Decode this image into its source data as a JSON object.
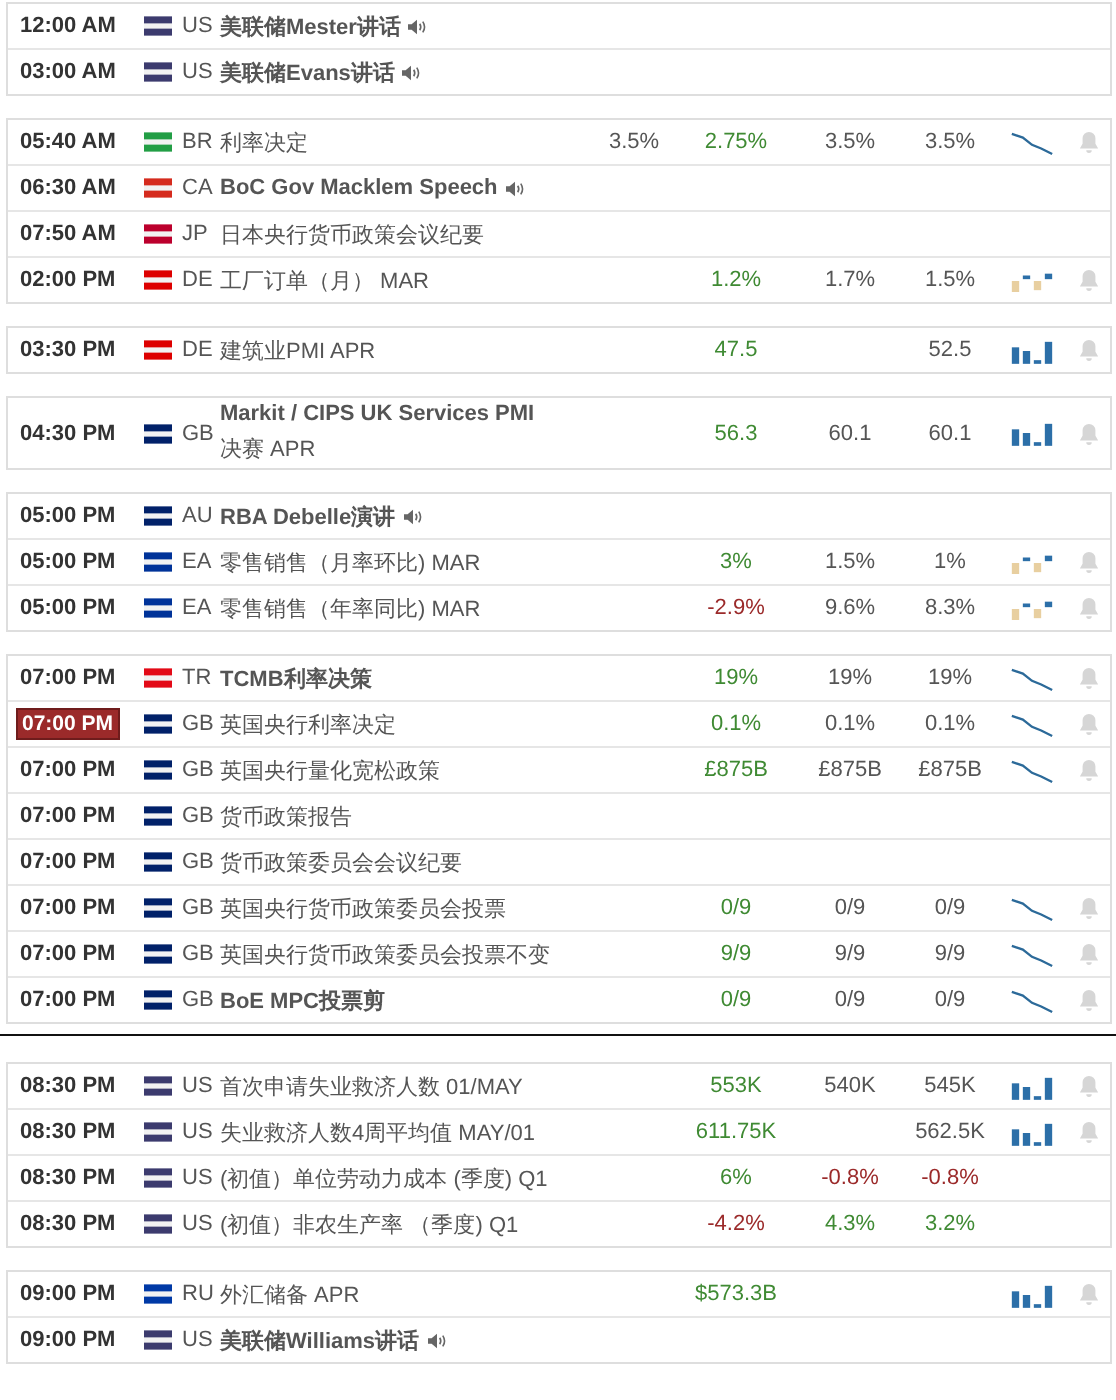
{
  "groups": [
    {
      "divider_after": false,
      "rows": [
        {
          "time": "12:00 AM",
          "highlighted": false,
          "color": "#3c3b6e",
          "country": "US",
          "title": "美联储Mester讲话",
          "bold": true,
          "speech": true,
          "alert": false
        },
        {
          "time": "03:00 AM",
          "highlighted": false,
          "color": "#3c3b6e",
          "country": "US",
          "title": "美联储Evans讲话",
          "bold": true,
          "speech": true,
          "alert": false
        }
      ]
    },
    {
      "divider_after": false,
      "rows": [
        {
          "time": "05:40 AM",
          "highlighted": false,
          "color": "#229e45",
          "country": "BR",
          "title": "利率决定",
          "bold": false,
          "speech": false,
          "column_1": {
            "text": "3.5%",
            "color": "#555555"
          },
          "column_2": {
            "text": "2.75%",
            "color": "#3f8a33"
          },
          "column_3": {
            "text": "3.5%",
            "color": "#555555"
          },
          "column_4": {
            "text": "3.5%",
            "color": "#555555"
          },
          "sparkline": {
            "kind": "line"
          },
          "alert": true
        },
        {
          "time": "06:30 AM",
          "highlighted": false,
          "color": "#d52b1e",
          "country": "CA",
          "title": "BoC Gov Macklem Speech",
          "bold": true,
          "speech": true,
          "alert": false
        },
        {
          "time": "07:50 AM",
          "highlighted": false,
          "color": "#bc002d",
          "country": "JP",
          "title": "日本央行货币政策会议纪要",
          "bold": false,
          "speech": false,
          "alert": false
        },
        {
          "time": "02:00 PM",
          "highlighted": false,
          "color": "#dd0000",
          "country": "DE",
          "title": "工厂订单（月） MAR",
          "bold": false,
          "speech": false,
          "column_2": {
            "text": "1.2%",
            "color": "#3f8a33"
          },
          "column_3": {
            "text": "1.7%",
            "color": "#555555"
          },
          "column_4": {
            "text": "1.5%",
            "color": "#555555"
          },
          "sparkline": {
            "kind": "mixed"
          },
          "alert": true
        }
      ]
    },
    {
      "divider_after": false,
      "rows": [
        {
          "time": "03:30 PM",
          "highlighted": false,
          "color": "#dd0000",
          "country": "DE",
          "title": "建筑业PMI APR",
          "bold": false,
          "speech": false,
          "column_2": {
            "text": "47.5",
            "color": "#3f8a33"
          },
          "column_4": {
            "text": "52.5",
            "color": "#555555"
          },
          "sparkline": {
            "kind": "bars"
          },
          "alert": true
        }
      ]
    },
    {
      "divider_after": false,
      "rows": [
        {
          "time": "04:30 PM",
          "highlighted": false,
          "color": "#012169",
          "country": "GB",
          "title": "Markit / CIPS UK Services PMI",
          "subtitle": "决赛 APR",
          "bold": true,
          "speech": false,
          "column_2": {
            "text": "56.3",
            "color": "#3f8a33"
          },
          "column_3": {
            "text": "60.1",
            "color": "#555555"
          },
          "column_4": {
            "text": "60.1",
            "color": "#555555"
          },
          "sparkline": {
            "kind": "bars"
          },
          "alert": true
        }
      ]
    },
    {
      "divider_after": false,
      "rows": [
        {
          "time": "05:00 PM",
          "highlighted": false,
          "color": "#012169",
          "country": "AU",
          "title": "RBA Debelle演讲",
          "bold": true,
          "speech": true,
          "alert": false
        },
        {
          "time": "05:00 PM",
          "highlighted": false,
          "color": "#003399",
          "country": "EA",
          "title": "零售销售（月率环比) MAR",
          "bold": false,
          "speech": false,
          "column_2": {
            "text": "3%",
            "color": "#3f8a33"
          },
          "column_3": {
            "text": "1.5%",
            "color": "#555555"
          },
          "column_4": {
            "text": "1%",
            "color": "#555555"
          },
          "sparkline": {
            "kind": "mixed"
          },
          "alert": true
        },
        {
          "time": "05:00 PM",
          "highlighted": false,
          "color": "#003399",
          "country": "EA",
          "title": "零售销售（年率同比) MAR",
          "bold": false,
          "speech": false,
          "column_2": {
            "text": "-2.9%",
            "color": "#9b2a2a"
          },
          "column_3": {
            "text": "9.6%",
            "color": "#555555"
          },
          "column_4": {
            "text": "8.3%",
            "color": "#555555"
          },
          "sparkline": {
            "kind": "mixed"
          },
          "alert": true
        }
      ]
    },
    {
      "divider_after": true,
      "rows": [
        {
          "time": "07:00 PM",
          "highlighted": false,
          "color": "#e30a17",
          "country": "TR",
          "title": "TCMB利率决策",
          "bold": true,
          "speech": false,
          "column_2": {
            "text": "19%",
            "color": "#3f8a33"
          },
          "column_3": {
            "text": "19%",
            "color": "#555555"
          },
          "column_4": {
            "text": "19%",
            "color": "#555555"
          },
          "sparkline": {
            "kind": "line"
          },
          "alert": true
        },
        {
          "time": "07:00 PM",
          "highlighted": true,
          "color": "#012169",
          "country": "GB",
          "title": "英国央行利率决定",
          "bold": false,
          "speech": false,
          "column_2": {
            "text": "0.1%",
            "color": "#3f8a33"
          },
          "column_3": {
            "text": "0.1%",
            "color": "#555555"
          },
          "column_4": {
            "text": "0.1%",
            "color": "#555555"
          },
          "sparkline": {
            "kind": "line"
          },
          "alert": true
        },
        {
          "time": "07:00 PM",
          "highlighted": false,
          "color": "#012169",
          "country": "GB",
          "title": "英国央行量化宽松政策",
          "bold": false,
          "speech": false,
          "column_2": {
            "text": "£875B",
            "color": "#3f8a33"
          },
          "column_3": {
            "text": "£875B",
            "color": "#555555"
          },
          "column_4": {
            "text": "£875B",
            "color": "#555555"
          },
          "sparkline": {
            "kind": "line"
          },
          "alert": true
        },
        {
          "time": "07:00 PM",
          "highlighted": false,
          "color": "#012169",
          "country": "GB",
          "title": "货币政策报告",
          "bold": false,
          "speech": false,
          "alert": false
        },
        {
          "time": "07:00 PM",
          "highlighted": false,
          "color": "#012169",
          "country": "GB",
          "title": "货币政策委员会会议纪要",
          "bold": false,
          "speech": false,
          "alert": false
        },
        {
          "time": "07:00 PM",
          "highlighted": false,
          "color": "#012169",
          "country": "GB",
          "title": "英国央行货币政策委员会投票",
          "bold": false,
          "speech": false,
          "column_2": {
            "text": "0/9",
            "color": "#3f8a33"
          },
          "column_3": {
            "text": "0/9",
            "color": "#555555"
          },
          "column_4": {
            "text": "0/9",
            "color": "#555555"
          },
          "sparkline": {
            "kind": "line"
          },
          "alert": true
        },
        {
          "time": "07:00 PM",
          "highlighted": false,
          "color": "#012169",
          "country": "GB",
          "title": "英国央行货币政策委员会投票不变",
          "bold": false,
          "speech": false,
          "column_2": {
            "text": "9/9",
            "color": "#3f8a33"
          },
          "column_3": {
            "text": "9/9",
            "color": "#555555"
          },
          "column_4": {
            "text": "9/9",
            "color": "#555555"
          },
          "sparkline": {
            "kind": "line"
          },
          "alert": true
        },
        {
          "time": "07:00 PM",
          "highlighted": false,
          "color": "#012169",
          "country": "GB",
          "title": "BoE MPC投票剪",
          "bold": true,
          "speech": false,
          "column_2": {
            "text": "0/9",
            "color": "#3f8a33"
          },
          "column_3": {
            "text": "0/9",
            "color": "#555555"
          },
          "column_4": {
            "text": "0/9",
            "color": "#555555"
          },
          "sparkline": {
            "kind": "line"
          },
          "alert": true
        }
      ]
    },
    {
      "divider_after": false,
      "rows": [
        {
          "time": "08:30 PM",
          "highlighted": false,
          "color": "#3c3b6e",
          "country": "US",
          "title": "首次申请失业救济人数 01/MAY",
          "bold": false,
          "speech": false,
          "column_2": {
            "text": "553K",
            "color": "#3f8a33"
          },
          "column_3": {
            "text": "540K",
            "color": "#555555"
          },
          "column_4": {
            "text": "545K",
            "color": "#555555"
          },
          "sparkline": {
            "kind": "bars"
          },
          "alert": true
        },
        {
          "time": "08:30 PM",
          "highlighted": false,
          "color": "#3c3b6e",
          "country": "US",
          "title": "失业救济人数4周平均值 MAY/01",
          "bold": false,
          "speech": false,
          "column_2": {
            "text": "611.75K",
            "color": "#3f8a33"
          },
          "column_4": {
            "text": "562.5K",
            "color": "#555555"
          },
          "sparkline": {
            "kind": "bars"
          },
          "alert": true
        },
        {
          "time": "08:30 PM",
          "highlighted": false,
          "color": "#3c3b6e",
          "country": "US",
          "title": "(初值）单位劳动力成本 (季度) Q1",
          "bold": false,
          "speech": false,
          "column_2": {
            "text": "6%",
            "color": "#3f8a33"
          },
          "column_3": {
            "text": "-0.8%",
            "color": "#9b2a2a"
          },
          "column_4": {
            "text": "-0.8%",
            "color": "#9b2a2a"
          },
          "alert": false
        },
        {
          "time": "08:30 PM",
          "highlighted": false,
          "color": "#3c3b6e",
          "country": "US",
          "title": "(初值）非农生产率 （季度) Q1",
          "bold": false,
          "speech": false,
          "column_2": {
            "text": "-4.2%",
            "color": "#9b2a2a"
          },
          "column_3": {
            "text": "4.3%",
            "color": "#3f8a33"
          },
          "column_4": {
            "text": "3.2%",
            "color": "#3f8a33"
          },
          "alert": false
        }
      ]
    },
    {
      "divider_after": false,
      "rows": [
        {
          "time": "09:00 PM",
          "highlighted": false,
          "color": "#0039a6",
          "country": "RU",
          "title": "外汇储备 APR",
          "bold": false,
          "speech": false,
          "column_2": {
            "text": "$573.3B",
            "color": "#3f8a33"
          },
          "sparkline": {
            "kind": "bars"
          },
          "alert": true
        },
        {
          "time": "09:00 PM",
          "highlighted": false,
          "color": "#3c3b6e",
          "country": "US",
          "title": "美联储Williams讲话",
          "bold": true,
          "speech": true,
          "alert": false
        }
      ]
    }
  ]
}
